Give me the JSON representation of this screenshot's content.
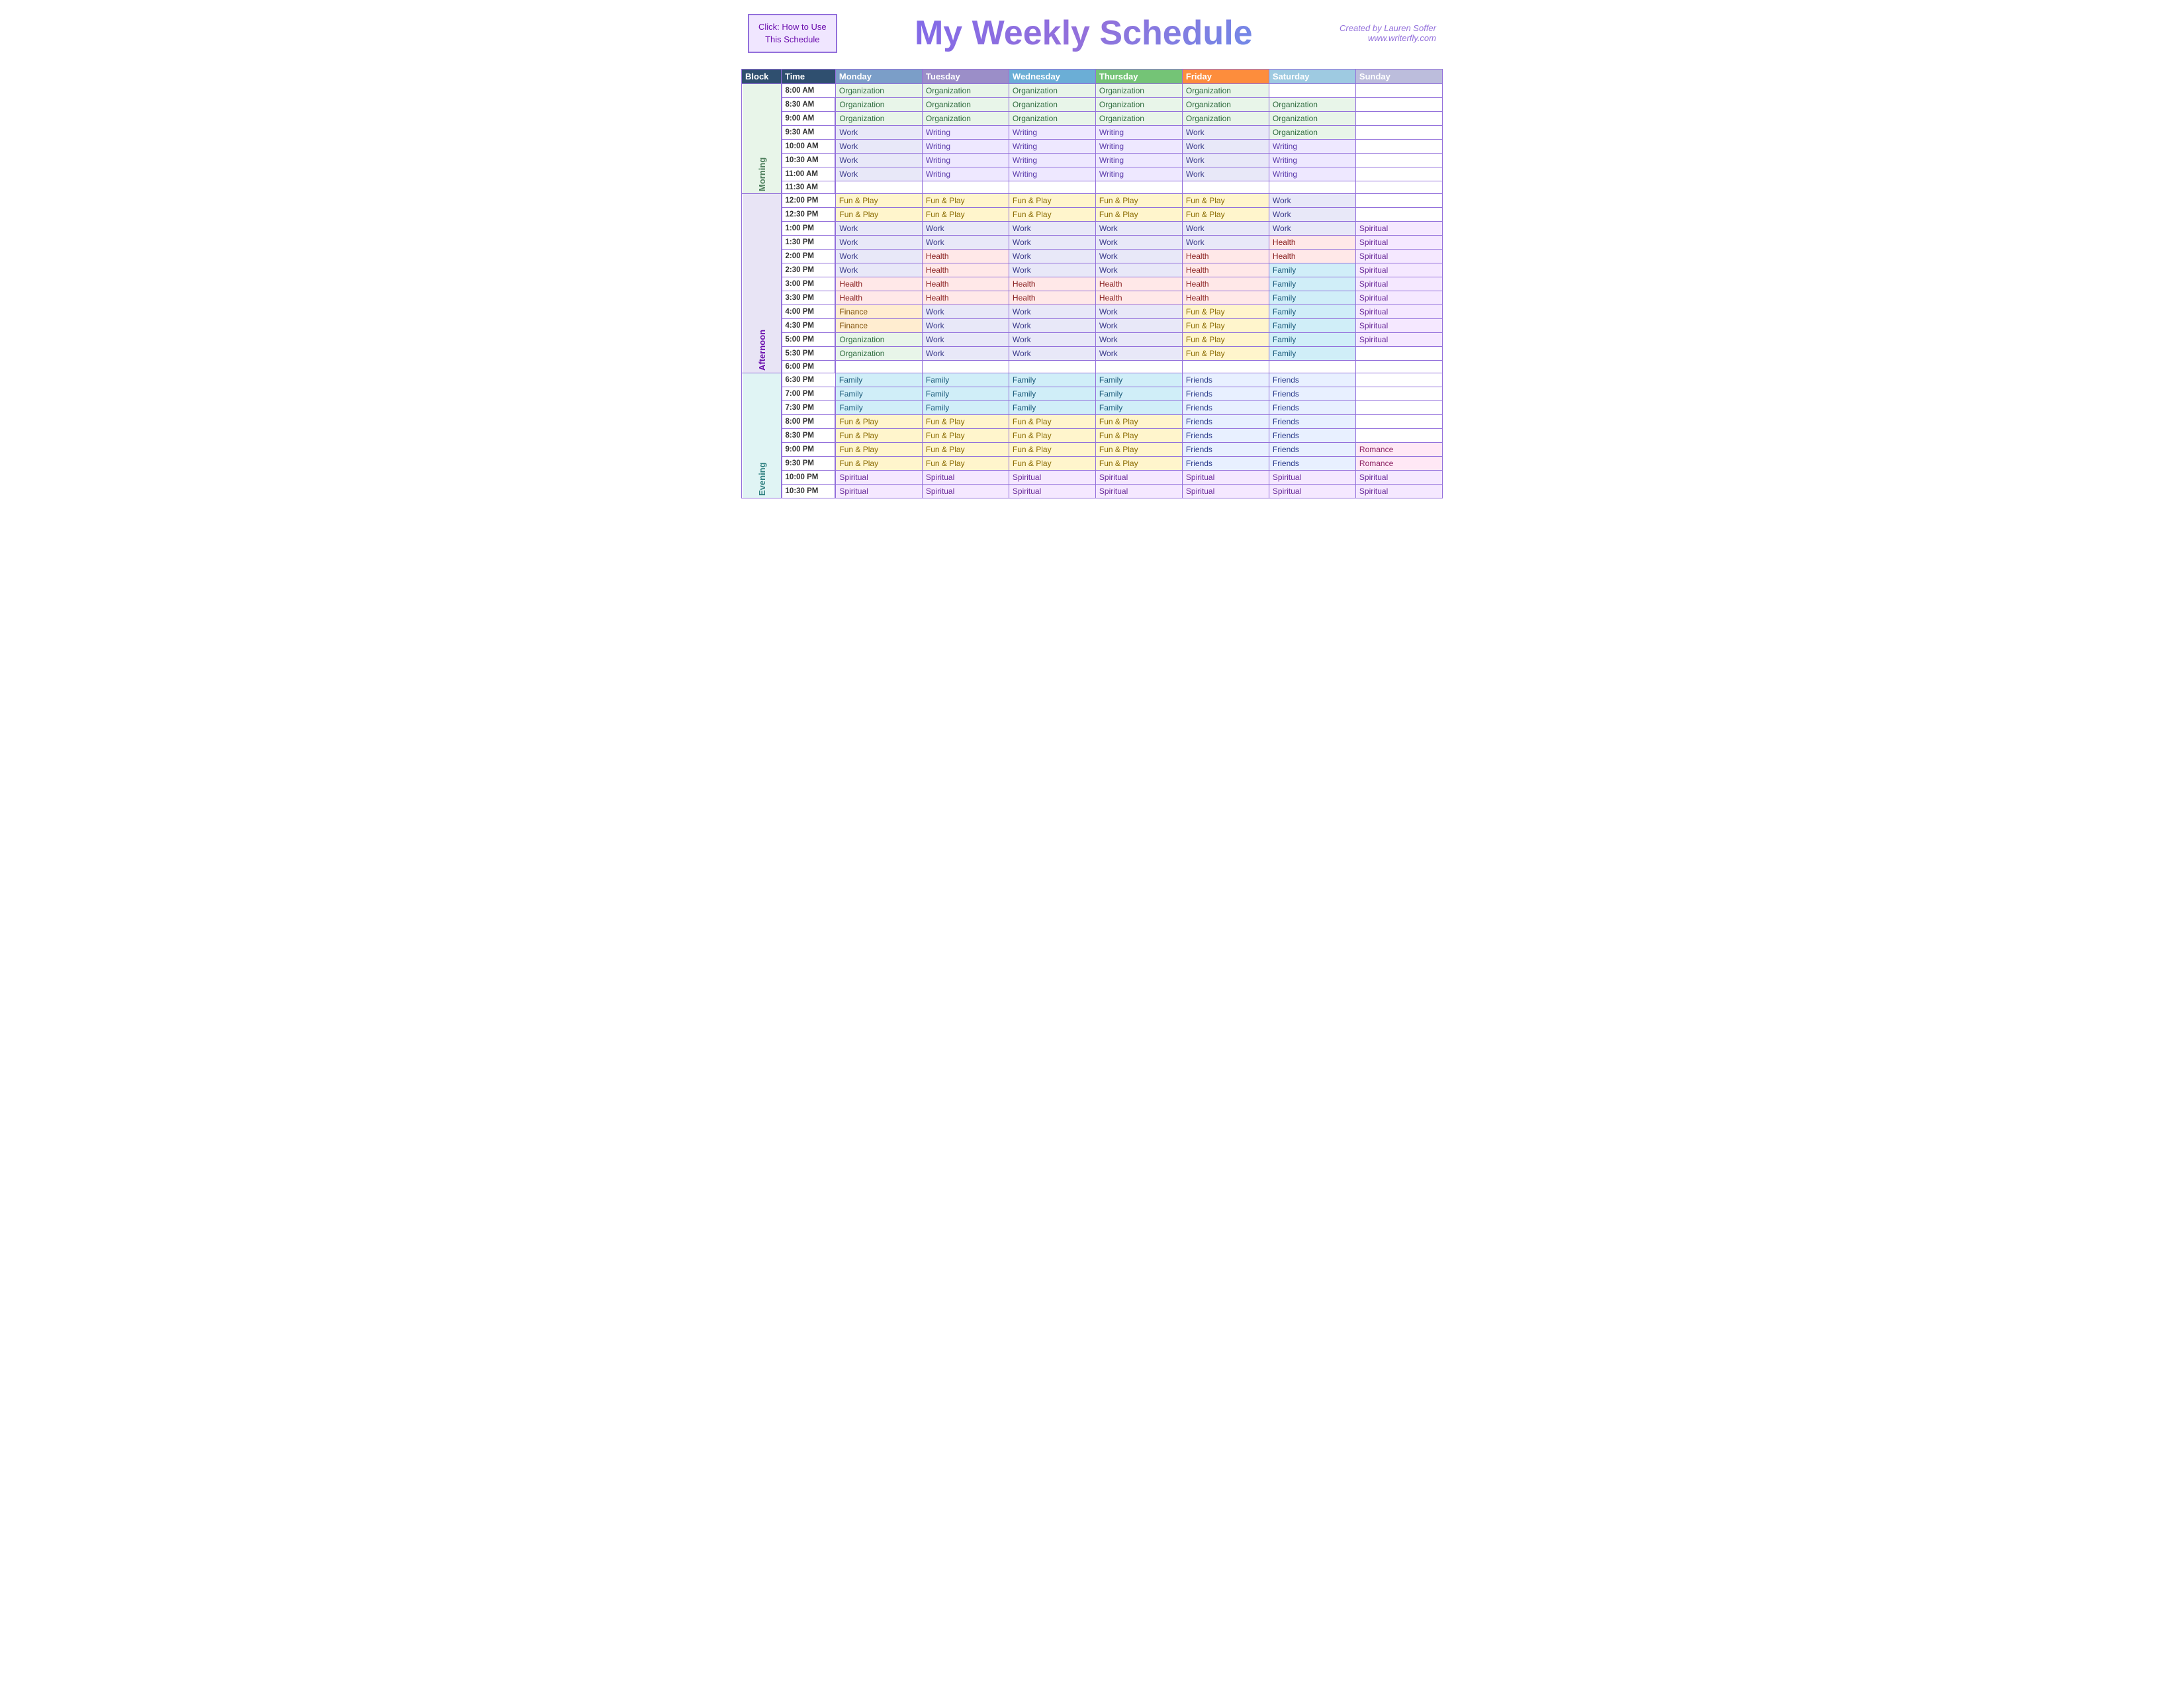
{
  "header": {
    "click_box_line1": "Click:  How to Use",
    "click_box_line2": "This Schedule",
    "title": "My Weekly Schedule",
    "creator_name": "Created by Lauren Soffer",
    "creator_url": "www.writerfly.com"
  },
  "table": {
    "columns": [
      "Block",
      "Time",
      "Monday",
      "Tuesday",
      "Wednesday",
      "Thursday",
      "Friday",
      "Saturday",
      "Sunday"
    ],
    "blocks": [
      {
        "name": "Morning",
        "rows": [
          {
            "time": "8:00 AM",
            "mon": "Organization",
            "tue": "Organization",
            "wed": "Organization",
            "thu": "Organization",
            "fri": "Organization",
            "sat": "",
            "sun": ""
          },
          {
            "time": "8:30 AM",
            "mon": "Organization",
            "tue": "Organization",
            "wed": "Organization",
            "thu": "Organization",
            "fri": "Organization",
            "sat": "Organization",
            "sun": ""
          },
          {
            "time": "9:00 AM",
            "mon": "Organization",
            "tue": "Organization",
            "wed": "Organization",
            "thu": "Organization",
            "fri": "Organization",
            "sat": "Organization",
            "sun": ""
          },
          {
            "time": "9:30 AM",
            "mon": "Work",
            "tue": "Writing",
            "wed": "Writing",
            "thu": "Writing",
            "fri": "Work",
            "sat": "Organization",
            "sun": ""
          },
          {
            "time": "10:00 AM",
            "mon": "Work",
            "tue": "Writing",
            "wed": "Writing",
            "thu": "Writing",
            "fri": "Work",
            "sat": "Writing",
            "sun": ""
          },
          {
            "time": "10:30 AM",
            "mon": "Work",
            "tue": "Writing",
            "wed": "Writing",
            "thu": "Writing",
            "fri": "Work",
            "sat": "Writing",
            "sun": ""
          },
          {
            "time": "11:00 AM",
            "mon": "Work",
            "tue": "Writing",
            "wed": "Writing",
            "thu": "Writing",
            "fri": "Work",
            "sat": "Writing",
            "sun": ""
          },
          {
            "time": "11:30 AM",
            "mon": "",
            "tue": "",
            "wed": "",
            "thu": "",
            "fri": "",
            "sat": "",
            "sun": ""
          }
        ]
      },
      {
        "name": "Afternoon",
        "rows": [
          {
            "time": "12:00 PM",
            "mon": "Fun & Play",
            "tue": "Fun & Play",
            "wed": "Fun & Play",
            "thu": "Fun & Play",
            "fri": "Fun & Play",
            "sat": "Work",
            "sun": ""
          },
          {
            "time": "12:30 PM",
            "mon": "Fun & Play",
            "tue": "Fun & Play",
            "wed": "Fun & Play",
            "thu": "Fun & Play",
            "fri": "Fun & Play",
            "sat": "Work",
            "sun": ""
          },
          {
            "time": "1:00 PM",
            "mon": "Work",
            "tue": "Work",
            "wed": "Work",
            "thu": "Work",
            "fri": "Work",
            "sat": "Work",
            "sun": "Spiritual"
          },
          {
            "time": "1:30 PM",
            "mon": "Work",
            "tue": "Work",
            "wed": "Work",
            "thu": "Work",
            "fri": "Work",
            "sat": "Health",
            "sun": "Spiritual"
          },
          {
            "time": "2:00 PM",
            "mon": "Work",
            "tue": "Health",
            "wed": "Work",
            "thu": "Work",
            "fri": "Health",
            "sat": "Health",
            "sun": "Spiritual"
          },
          {
            "time": "2:30 PM",
            "mon": "Work",
            "tue": "Health",
            "wed": "Work",
            "thu": "Work",
            "fri": "Health",
            "sat": "Family",
            "sun": "Spiritual"
          },
          {
            "time": "3:00 PM",
            "mon": "Health",
            "tue": "Health",
            "wed": "Health",
            "thu": "Health",
            "fri": "Health",
            "sat": "Family",
            "sun": "Spiritual"
          },
          {
            "time": "3:30 PM",
            "mon": "Health",
            "tue": "Health",
            "wed": "Health",
            "thu": "Health",
            "fri": "Health",
            "sat": "Family",
            "sun": "Spiritual"
          },
          {
            "time": "4:00 PM",
            "mon": "Finance",
            "tue": "Work",
            "wed": "Work",
            "thu": "Work",
            "fri": "Fun & Play",
            "sat": "Family",
            "sun": "Spiritual"
          },
          {
            "time": "4:30 PM",
            "mon": "Finance",
            "tue": "Work",
            "wed": "Work",
            "thu": "Work",
            "fri": "Fun & Play",
            "sat": "Family",
            "sun": "Spiritual"
          },
          {
            "time": "5:00 PM",
            "mon": "Organization",
            "tue": "Work",
            "wed": "Work",
            "thu": "Work",
            "fri": "Fun & Play",
            "sat": "Family",
            "sun": "Spiritual"
          },
          {
            "time": "5:30 PM",
            "mon": "Organization",
            "tue": "Work",
            "wed": "Work",
            "thu": "Work",
            "fri": "Fun & Play",
            "sat": "Family",
            "sun": ""
          },
          {
            "time": "6:00 PM",
            "mon": "",
            "tue": "",
            "wed": "",
            "thu": "",
            "fri": "",
            "sat": "",
            "sun": ""
          }
        ]
      },
      {
        "name": "Evening",
        "rows": [
          {
            "time": "6:30 PM",
            "mon": "Family",
            "tue": "Family",
            "wed": "Family",
            "thu": "Family",
            "fri": "Friends",
            "sat": "Friends",
            "sun": ""
          },
          {
            "time": "7:00 PM",
            "mon": "Family",
            "tue": "Family",
            "wed": "Family",
            "thu": "Family",
            "fri": "Friends",
            "sat": "Friends",
            "sun": ""
          },
          {
            "time": "7:30 PM",
            "mon": "Family",
            "tue": "Family",
            "wed": "Family",
            "thu": "Family",
            "fri": "Friends",
            "sat": "Friends",
            "sun": ""
          },
          {
            "time": "8:00 PM",
            "mon": "Fun & Play",
            "tue": "Fun & Play",
            "wed": "Fun & Play",
            "thu": "Fun & Play",
            "fri": "Friends",
            "sat": "Friends",
            "sun": ""
          },
          {
            "time": "8:30 PM",
            "mon": "Fun & Play",
            "tue": "Fun & Play",
            "wed": "Fun & Play",
            "thu": "Fun & Play",
            "fri": "Friends",
            "sat": "Friends",
            "sun": ""
          },
          {
            "time": "9:00 PM",
            "mon": "Fun & Play",
            "tue": "Fun & Play",
            "wed": "Fun & Play",
            "thu": "Fun & Play",
            "fri": "Friends",
            "sat": "Friends",
            "sun": "Romance"
          },
          {
            "time": "9:30 PM",
            "mon": "Fun & Play",
            "tue": "Fun & Play",
            "wed": "Fun & Play",
            "thu": "Fun & Play",
            "fri": "Friends",
            "sat": "Friends",
            "sun": "Romance"
          },
          {
            "time": "10:00 PM",
            "mon": "Spiritual",
            "tue": "Spiritual",
            "wed": "Spiritual",
            "thu": "Spiritual",
            "fri": "Spiritual",
            "sat": "Spiritual",
            "sun": "Spiritual"
          },
          {
            "time": "10:30 PM",
            "mon": "Spiritual",
            "tue": "Spiritual",
            "wed": "Spiritual",
            "thu": "Spiritual",
            "fri": "Spiritual",
            "sat": "Spiritual",
            "sun": "Spiritual"
          }
        ]
      }
    ]
  }
}
